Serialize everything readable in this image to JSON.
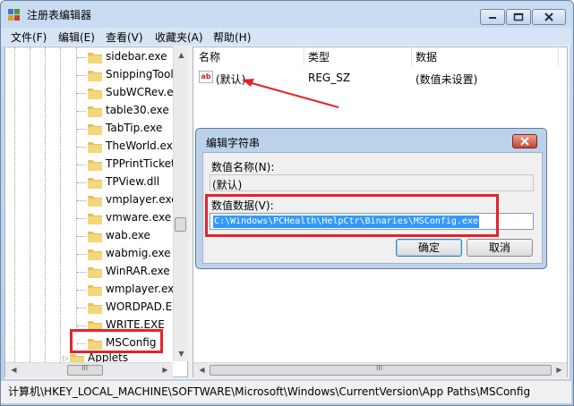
{
  "window": {
    "title": "注册表编辑器"
  },
  "menu": [
    "文件(F)",
    "编辑(E)",
    "查看(V)",
    "收藏夹(A)",
    "帮助(H)"
  ],
  "tree": {
    "items": [
      "sidebar.exe",
      "SnippingTool",
      "SubWCRev.ex",
      "table30.exe",
      "TabTip.exe",
      "TheWorld.exe",
      "TPPrintTicket.",
      "TPView.dll",
      "vmplayer.exe",
      "vmware.exe",
      "wab.exe",
      "wabmig.exe",
      "WinRAR.exe",
      "wmplayer.exe",
      "WORDPAD.EX",
      "WRITE.EXE",
      "MSConfig"
    ],
    "partial_item": "Applets",
    "scroll_h_label": "III"
  },
  "list": {
    "columns": [
      "名称",
      "类型",
      "数据"
    ],
    "rows": [
      {
        "name": "(默认)",
        "type": "REG_SZ",
        "data": "(数值未设置)",
        "icon": "ab-string-icon"
      }
    ],
    "scroll_h_label": "III"
  },
  "dialog": {
    "title": "编辑字符串",
    "name_label": "数值名称(N):",
    "name_value": "(默认)",
    "data_label": "数值数据(V):",
    "data_value": "C:\\Windows\\PCHealth\\HelpCtr\\Binaries\\MSConfig.exe",
    "ok_label": "确定",
    "cancel_label": "取消"
  },
  "statusbar": {
    "path": "计算机\\HKEY_LOCAL_MACHINE\\SOFTWARE\\Microsoft\\Windows\\CurrentVersion\\App Paths\\MSConfig"
  },
  "colors": {
    "highlight": "#e3242b",
    "selection": "#3399ff",
    "frame": "#b6cde9"
  }
}
